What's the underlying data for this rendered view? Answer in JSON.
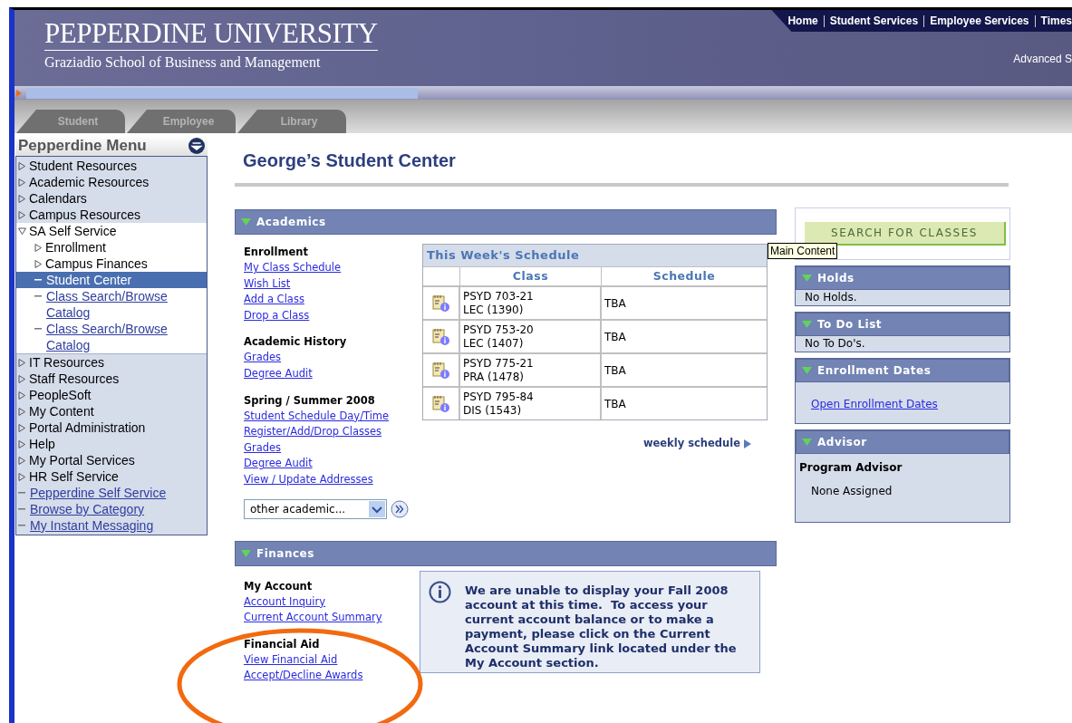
{
  "header": {
    "logo_title": "PEPPERDINE UNIVERSITY",
    "logo_subtitle": "Graziadio School of Business and Management",
    "top_links": [
      "Home",
      "Student Services",
      "Employee Services",
      "Times"
    ],
    "advanced_link": "Advanced S"
  },
  "tabs": [
    {
      "label": "Student"
    },
    {
      "label": "Employee"
    },
    {
      "label": "Library"
    }
  ],
  "menu": {
    "title": "Pepperdine Menu",
    "items": [
      {
        "label": "Student Resources",
        "kind": "folder",
        "expanded": false,
        "selected": false
      },
      {
        "label": "Academic Resources",
        "kind": "folder",
        "expanded": false,
        "selected": false
      },
      {
        "label": "Calendars",
        "kind": "folder",
        "expanded": false,
        "selected": false
      },
      {
        "label": "Campus Resources",
        "kind": "folder",
        "expanded": false,
        "selected": false
      },
      {
        "label": "SA Self Service",
        "kind": "folder",
        "expanded": true,
        "selected": false,
        "children": [
          {
            "label": "Enrollment",
            "kind": "folder",
            "expanded": false,
            "selected": false
          },
          {
            "label": "Campus Finances",
            "kind": "folder",
            "expanded": false,
            "selected": false
          },
          {
            "label": "Student Center",
            "kind": "link",
            "selected": true
          },
          {
            "label": "Class Search/Browse Catalog",
            "kind": "link",
            "selected": false
          },
          {
            "label": "Class Search/Browse Catalog",
            "kind": "link",
            "selected": false
          }
        ]
      },
      {
        "label": "IT Resources",
        "kind": "folder",
        "expanded": false,
        "selected": false
      },
      {
        "label": "Staff Resources",
        "kind": "folder",
        "expanded": false,
        "selected": false
      },
      {
        "label": "PeopleSoft",
        "kind": "folder",
        "expanded": false,
        "selected": false
      },
      {
        "label": "My Content",
        "kind": "folder",
        "expanded": false,
        "selected": false
      },
      {
        "label": "Portal Administration",
        "kind": "folder",
        "expanded": false,
        "selected": false
      },
      {
        "label": "Help",
        "kind": "folder",
        "expanded": false,
        "selected": false
      },
      {
        "label": "My Portal Services",
        "kind": "folder",
        "expanded": false,
        "selected": false
      },
      {
        "label": "HR Self Service",
        "kind": "folder",
        "expanded": false,
        "selected": false
      },
      {
        "label": "Pepperdine Self Service",
        "kind": "link",
        "selected": false
      },
      {
        "label": "Browse by Category",
        "kind": "link",
        "selected": false
      },
      {
        "label": "My Instant Messaging",
        "kind": "link",
        "selected": false
      }
    ]
  },
  "page_title": "George’s Student Center",
  "academics": {
    "title": "Academics",
    "groups": [
      {
        "heading": "Enrollment",
        "links": [
          "My Class Schedule",
          "Wish List",
          "Add a Class",
          "Drop a Class"
        ]
      },
      {
        "heading": "Academic History",
        "links": [
          "Grades",
          "Degree Audit"
        ]
      },
      {
        "heading": "Spring / Summer 2008",
        "links": [
          "Student Schedule Day/Time",
          "Register/Add/Drop Classes",
          "Grades",
          "Degree Audit",
          "View / Update Addresses"
        ]
      }
    ],
    "dropdown": {
      "value": "other academic..."
    },
    "schedule": {
      "title": "This Week's Schedule",
      "columns": [
        "Class",
        "Schedule"
      ],
      "rows": [
        {
          "class_lines": [
            "PSYD 703-21",
            "LEC (1390)"
          ],
          "schedule": "TBA"
        },
        {
          "class_lines": [
            "PSYD 753-20",
            "LEC (1407)"
          ],
          "schedule": "TBA"
        },
        {
          "class_lines": [
            "PSYD 775-21",
            "PRA (1478)"
          ],
          "schedule": "TBA"
        },
        {
          "class_lines": [
            "PSYD 795-84",
            "DIS (1543)"
          ],
          "schedule": "TBA"
        }
      ]
    },
    "weekly_link": "weekly schedule"
  },
  "finances": {
    "title": "Finances",
    "groups": [
      {
        "heading": "My Account",
        "links": [
          "Account Inquiry",
          "Current Account Summary"
        ]
      },
      {
        "heading": "Financial Aid",
        "links": [
          "View Financial Aid",
          "Accept/Decline Awards"
        ]
      }
    ],
    "notice": "We are unable to display your Fall 2008 account at this time.  To access your current account balance or to make a payment, please click on the Current Account Summary link located under the My Account section."
  },
  "search_button": "SEARCH FOR CLASSES",
  "tooltip": "Main Content",
  "side_panels": [
    {
      "title": "Holds",
      "kind": "text",
      "text": "No Holds."
    },
    {
      "title": "To Do List",
      "kind": "text",
      "text": "No To Do's."
    },
    {
      "title": "Enrollment Dates",
      "kind": "link",
      "text": "Open Enrollment Dates"
    },
    {
      "title": "Advisor",
      "kind": "advisor",
      "heading": "Program Advisor",
      "text": "None Assigned"
    }
  ]
}
